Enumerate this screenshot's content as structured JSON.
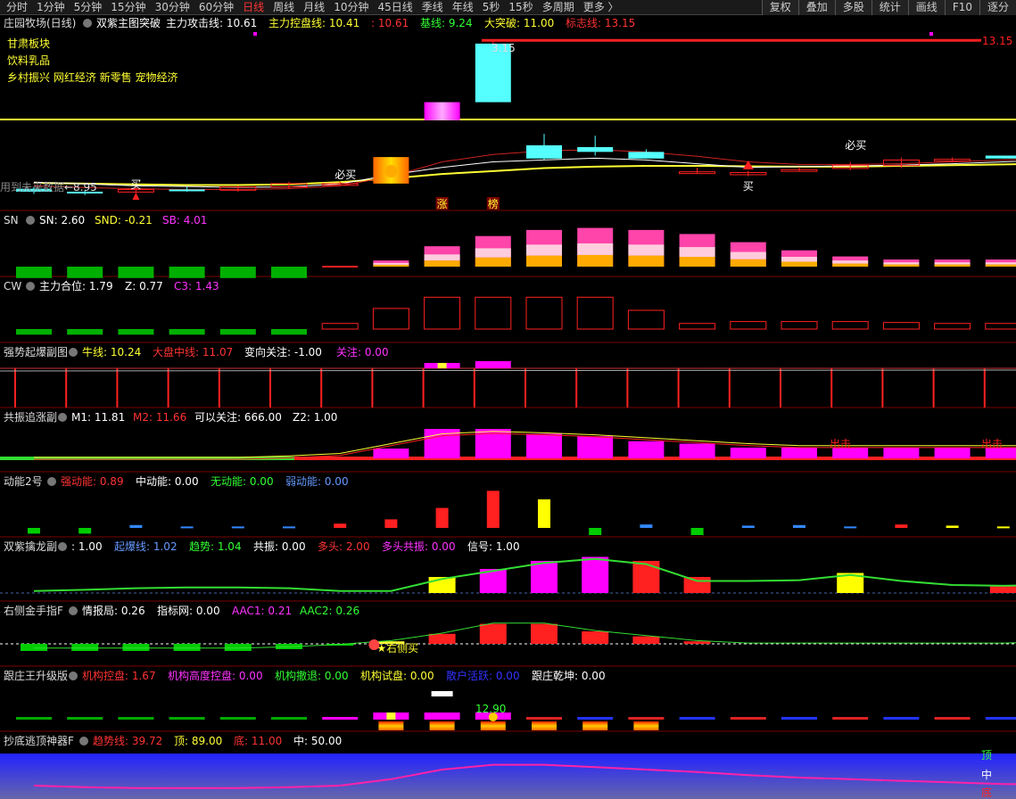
{
  "toolbar": {
    "tabs": [
      "分时",
      "1分钟",
      "5分钟",
      "15分钟",
      "30分钟",
      "60分钟",
      "日线",
      "周线",
      "月线",
      "10分钟",
      "45日线",
      "季线",
      "年线",
      "5秒",
      "15秒",
      "多周期",
      "更多 〉"
    ],
    "active_index": 6,
    "tools": [
      "复权",
      "叠加",
      "多股",
      "统计",
      "画线",
      "F10",
      "逐分"
    ]
  },
  "colors": {
    "up": "#ff2020",
    "down": "#00b000",
    "yellow": "#ffff33",
    "magenta": "#ff00ff",
    "cyan": "#55ffff",
    "blue": "#3366ff",
    "white": "#ffffff",
    "orange": "#ffaa00",
    "pink": "#ff88cc"
  },
  "main_panel": {
    "stock": "庄园牧场(日线)",
    "indicator": "双紫主图突破",
    "legend": [
      {
        "label": "主力攻击线: 10.61",
        "color": "#ffffff"
      },
      {
        "label": "主力控盘线: 10.41",
        "color": "#ffff33"
      },
      {
        "label": ": 10.61",
        "color": "#ff3333"
      },
      {
        "label": "基线: 9.24",
        "color": "#33ff33"
      },
      {
        "label": "大突破: 11.00",
        "color": "#ffff33"
      },
      {
        "label": "标志线: 13.15",
        "color": "#ff3333"
      }
    ],
    "tips": [
      "甘肃板块",
      "饮料乳品",
      "乡村振兴  网红经济  新零售  宠物经济"
    ],
    "warning": "用到未来数据",
    "low_label": "←8.95",
    "high_label": "3.15",
    "right_label": "13.15",
    "buy_labels": [
      "买",
      "必买",
      "买",
      "必买"
    ],
    "tag_labels": [
      "涨",
      "榜"
    ],
    "candles": [
      {
        "o": 9.12,
        "c": 9.04,
        "h": 9.17,
        "l": 8.98
      },
      {
        "o": 9.04,
        "c": 9.03,
        "h": 9.09,
        "l": 8.95
      },
      {
        "o": 9.03,
        "c": 9.1,
        "h": 9.16,
        "l": 9.0
      },
      {
        "o": 9.1,
        "c": 9.08,
        "h": 9.17,
        "l": 9.04
      },
      {
        "o": 9.08,
        "c": 9.17,
        "h": 9.2,
        "l": 9.04
      },
      {
        "o": 9.17,
        "c": 9.26,
        "h": 9.31,
        "l": 9.12
      },
      {
        "o": 9.26,
        "c": 9.26,
        "h": 9.31,
        "l": 9.21
      },
      {
        "o": 9.26,
        "c": 9.98,
        "h": 9.98,
        "l": 9.26
      },
      {
        "o": 10.98,
        "c": 11.47,
        "h": 11.47,
        "l": 10.98
      },
      {
        "o": 11.47,
        "c": 13.06,
        "h": 13.15,
        "l": 11.47
      },
      {
        "o": 10.3,
        "c": 9.94,
        "h": 10.61,
        "l": 9.9
      },
      {
        "o": 10.25,
        "c": 10.12,
        "h": 10.56,
        "l": 10.02
      },
      {
        "o": 10.12,
        "c": 9.94,
        "h": 10.19,
        "l": 9.94
      },
      {
        "o": 9.54,
        "c": 9.58,
        "h": 9.69,
        "l": 9.53
      },
      {
        "o": 9.5,
        "c": 9.56,
        "h": 9.61,
        "l": 9.46
      },
      {
        "o": 9.64,
        "c": 9.64,
        "h": 9.71,
        "l": 9.59
      },
      {
        "o": 9.67,
        "c": 9.76,
        "h": 9.85,
        "l": 9.62
      },
      {
        "o": 9.75,
        "c": 9.9,
        "h": 9.97,
        "l": 9.68
      },
      {
        "o": 9.9,
        "c": 9.92,
        "h": 9.97,
        "l": 9.86
      },
      {
        "o": 10.02,
        "c": 9.94,
        "h": 10.02,
        "l": 9.94
      },
      {
        "o": 10.0,
        "c": 10.08,
        "h": 10.1,
        "l": 9.95
      }
    ]
  },
  "panels": [
    {
      "id": "sn",
      "name": "SN",
      "legend": [
        {
          "label": "SN: 2.60",
          "color": "#ffffff"
        },
        {
          "label": "SND: -0.21",
          "color": "#ffff33"
        },
        {
          "label": "SB: 4.01",
          "color": "#ff33ff"
        }
      ],
      "values": [
        -0.8,
        -0.8,
        -0.8,
        -0.8,
        -0.8,
        -0.8,
        0,
        0.6,
        2.0,
        3.0,
        3.6,
        3.8,
        3.6,
        3.2,
        2.4,
        1.6,
        1.0,
        0.7,
        0.7,
        0.7,
        0.7
      ]
    },
    {
      "id": "cw",
      "name": "CW",
      "legend": [
        {
          "label": "主力合位: 1.79",
          "color": "#ffffff"
        },
        {
          "label": "Z: 0.77",
          "color": "#ffffff"
        },
        {
          "label": "C3: 1.43",
          "color": "#ff33ff"
        }
      ],
      "values": [
        -0.6,
        -0.6,
        -0.6,
        -0.6,
        -0.6,
        -0.6,
        0.6,
        2.2,
        3.4,
        3.4,
        3.4,
        3.4,
        2.0,
        0.6,
        0.8,
        0.8,
        0.8,
        0.7,
        0.6,
        0.6,
        0.9
      ]
    },
    {
      "id": "qs",
      "name": "强势起爆副图",
      "legend": [
        {
          "label": "牛线: 10.24",
          "color": "#ffff33"
        },
        {
          "label": "大盘中线: 11.07",
          "color": "#ff3333"
        },
        {
          "label": "变向关注: -1.00",
          "color": "#ffffff"
        },
        {
          "label": "关注: 0.00",
          "color": "#ff33ff"
        }
      ]
    },
    {
      "id": "gz",
      "name": "共振追涨副",
      "legend": [
        {
          "label": "M1: 11.81",
          "color": "#ffffff"
        },
        {
          "label": "M2: 11.66",
          "color": "#ff3333"
        },
        {
          "label": "可以关注: 666.00",
          "color": "#ffffff"
        },
        {
          "label": "Z2: 1.00",
          "color": "#ffffff"
        }
      ],
      "values": [
        0,
        0,
        0,
        0,
        0,
        0,
        0,
        0.2,
        0.6,
        0.6,
        0.5,
        0.45,
        0.35,
        0.3,
        0.22,
        0.22,
        0.22,
        0.22,
        0.22,
        0.22,
        0.22
      ],
      "out_label": "出击"
    },
    {
      "id": "dn",
      "name": "动能2号",
      "legend": [
        {
          "label": "强动能: 0.89",
          "color": "#ff3333"
        },
        {
          "label": "中动能: 0.00",
          "color": "#ffffff"
        },
        {
          "label": "无动能: 0.00",
          "color": "#33ff33"
        },
        {
          "label": "弱动能: 0.00",
          "color": "#6699ff"
        }
      ],
      "values": [
        0.2,
        0.2,
        0.1,
        0.05,
        0.05,
        0.05,
        0.15,
        0.3,
        0.7,
        1.3,
        1.0,
        0.25,
        0.12,
        0.25,
        0.08,
        0.1,
        0.05,
        0.12,
        0.08,
        0.05,
        0.08
      ]
    },
    {
      "id": "sz",
      "name": "双紫擒龙副",
      "legend": [
        {
          "label": ": 1.00",
          "color": "#ffffff"
        },
        {
          "label": "起爆线: 1.02",
          "color": "#6699ff"
        },
        {
          "label": "趋势: 1.04",
          "color": "#33ff33"
        },
        {
          "label": "共振: 0.00",
          "color": "#ffffff"
        },
        {
          "label": "多头: 2.00",
          "color": "#ff3333"
        },
        {
          "label": "多头共振: 0.00",
          "color": "#ff33ff"
        },
        {
          "label": "信号: 1.00",
          "color": "#ffffff"
        }
      ],
      "values": [
        0,
        0,
        0,
        0,
        0,
        0,
        0,
        0,
        0.4,
        0.6,
        0.8,
        0.9,
        0.8,
        0.4,
        0,
        0,
        0.5,
        0,
        0,
        0.2,
        0.2
      ]
    },
    {
      "id": "yc",
      "name": "右侧金手指F",
      "legend": [
        {
          "label": "情报局: 0.26",
          "color": "#ffffff"
        },
        {
          "label": "指标网: 0.00",
          "color": "#ffffff"
        },
        {
          "label": "AAC1: 0.21",
          "color": "#ff33ff"
        },
        {
          "label": "AAC2: 0.26",
          "color": "#33ff33"
        }
      ],
      "values": [
        -0.2,
        -0.2,
        -0.2,
        -0.2,
        -0.2,
        -0.15,
        -0.05,
        0.1,
        0.4,
        0.8,
        0.8,
        0.5,
        0.3,
        0.1,
        0,
        0,
        0,
        0,
        0,
        0,
        0.05
      ],
      "buy_label": "★右侧买"
    },
    {
      "id": "gzw",
      "name": "跟庄王升级版",
      "legend": [
        {
          "label": "机构控盘: 1.67",
          "color": "#ff3333"
        },
        {
          "label": "机构高度控盘: 0.00",
          "color": "#ff33ff"
        },
        {
          "label": "机构撤退: 0.00",
          "color": "#33ff33"
        },
        {
          "label": "机构试盘: 0.00",
          "color": "#ffff33"
        },
        {
          "label": "散户活跃: 0.00",
          "color": "#3333ff"
        },
        {
          "label": "跟庄乾坤: 0.00",
          "color": "#ffffff"
        }
      ],
      "price_label": "12.90"
    },
    {
      "id": "cd",
      "name": "抄底逃顶神器F",
      "legend": [
        {
          "label": "趋势线: 39.72",
          "color": "#ff3333"
        },
        {
          "label": "顶: 89.00",
          "color": "#ffff33"
        },
        {
          "label": "底: 11.00",
          "color": "#ff3333"
        },
        {
          "label": "中: 50.00",
          "color": "#ffffff"
        }
      ],
      "values": [
        10,
        8,
        7,
        7,
        7,
        8,
        10,
        18,
        30,
        36,
        36,
        33,
        30,
        27,
        23,
        20,
        18,
        16,
        14,
        12,
        11
      ],
      "side_labels": [
        "顶",
        "中",
        "底"
      ]
    }
  ]
}
